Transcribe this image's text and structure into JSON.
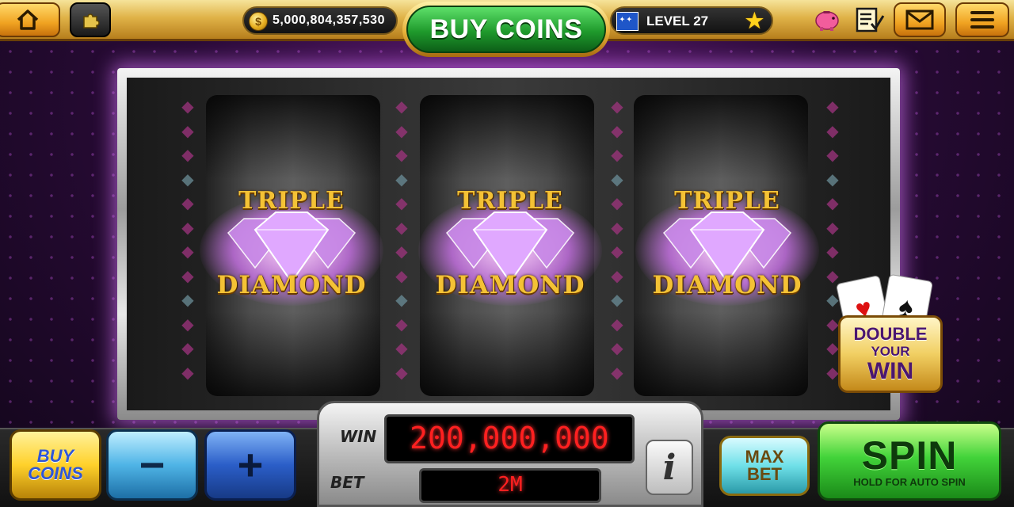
{
  "top_bar": {
    "home_icon": "home-icon",
    "puzzle_icon": "puzzle-icon",
    "coin_symbol": "$",
    "balance": "5,000,804,357,530",
    "buy_coins_label": "BUY COINS",
    "level_label": "LEVEL 27",
    "star_icon": "star-icon",
    "piggy_bank_icon": "piggy-bank-icon",
    "checklist_icon": "checklist-icon",
    "mail_icon": "mail-icon",
    "menu_icon": "menu-icon"
  },
  "reels": [
    {
      "symbol_top": "TRIPLE",
      "symbol_bottom": "DIAMOND"
    },
    {
      "symbol_top": "TRIPLE",
      "symbol_bottom": "DIAMOND"
    },
    {
      "symbol_top": "TRIPLE",
      "symbol_bottom": "DIAMOND"
    }
  ],
  "double_your_win": {
    "line1": "DOUBLE",
    "line2": "YOUR",
    "line3": "WIN"
  },
  "controls": {
    "buy_coins_line1": "BUY",
    "buy_coins_line2": "COINS",
    "minus_symbol": "−",
    "plus_symbol": "+",
    "win_label": "WIN",
    "win_value": "200,000,000",
    "bet_label": "BET",
    "bet_value": "2M",
    "info_symbol": "i",
    "max_bet_line1": "MAX",
    "max_bet_line2": "BET",
    "spin_label": "SPIN",
    "spin_hint": "HOLD FOR AUTO SPIN"
  },
  "colors": {
    "gold": "#f4c235",
    "buy_green": "#1f9a2c",
    "led_red": "#ff2020",
    "reel_glow": "#dc78ff"
  }
}
